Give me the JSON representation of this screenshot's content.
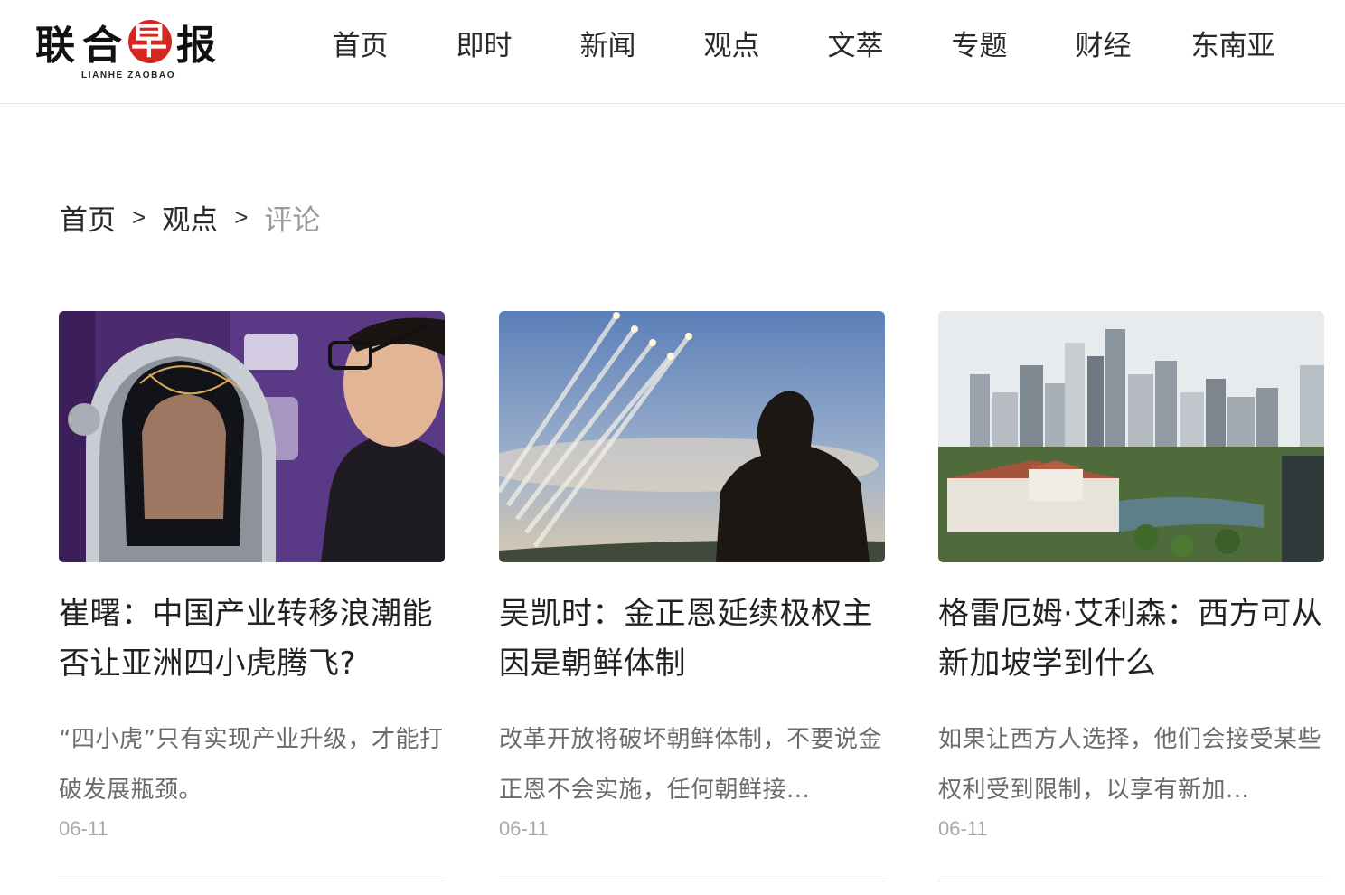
{
  "header": {
    "logo_zh_chars": [
      "联",
      "合",
      "早",
      "报"
    ],
    "logo_en": "LIANHE ZAOBAO",
    "logo_accent_color": "#d7251f",
    "nav": [
      "首页",
      "即时",
      "新闻",
      "观点",
      "文萃",
      "专题",
      "财经",
      "东南亚"
    ]
  },
  "breadcrumb": {
    "home": "首页",
    "separator": ">",
    "section": "观点",
    "current": "评论"
  },
  "articles": [
    {
      "image": "person wearing futuristic robotic helmet beside man with glasses",
      "title": "崔曙：中国产业转移浪潮能否让亚洲四小虎腾飞?",
      "summary": "“四小虎”只有实现产业升级，才能打破发展瓶颈。",
      "date": "06-11"
    },
    {
      "image": "silhouette of man watching missile launch in sky",
      "title": "吴凯时：金正恩延续极权主因是朝鲜体制",
      "summary": "改革开放将破坏朝鲜体制，不要说金正恩不会实施，任何朝鲜接...",
      "date": "06-11"
    },
    {
      "image": "Singapore city skyline with Parliament House",
      "title": "格雷厄姆·艾利森：西方可从新加坡学到什么",
      "summary": "如果让西方人选择，他们会接受某些权利受到限制，以享有新加...",
      "date": "06-11"
    }
  ]
}
